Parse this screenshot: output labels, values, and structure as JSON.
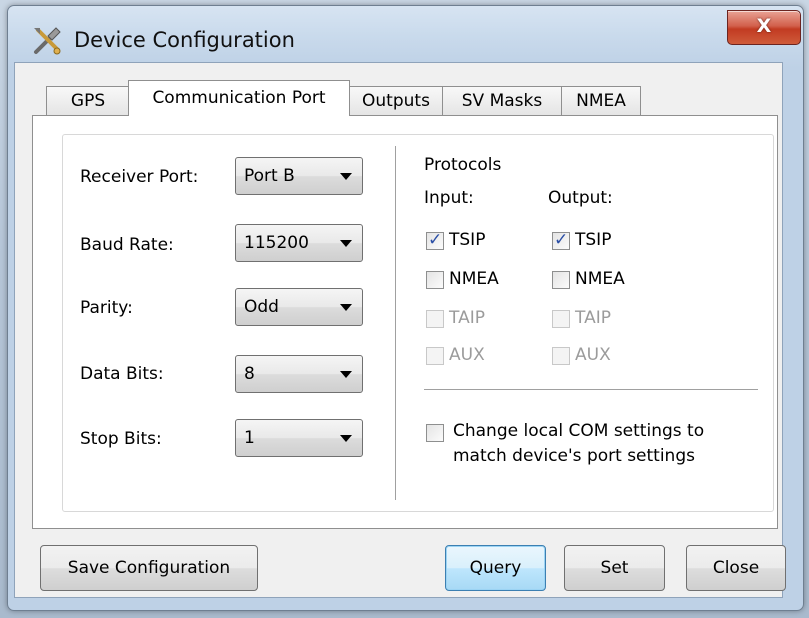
{
  "window": {
    "title": "Device Configuration",
    "close_label": "X"
  },
  "tabs": [
    {
      "label": "GPS"
    },
    {
      "label": "Communication Port"
    },
    {
      "label": "Outputs"
    },
    {
      "label": "SV Masks"
    },
    {
      "label": "NMEA"
    }
  ],
  "port_settings": {
    "receiver_port": {
      "label": "Receiver Port:",
      "value": "Port B"
    },
    "baud_rate": {
      "label": "Baud Rate:",
      "value": "115200"
    },
    "parity": {
      "label": "Parity:",
      "value": "Odd"
    },
    "data_bits": {
      "label": "Data Bits:",
      "value": "8"
    },
    "stop_bits": {
      "label": "Stop Bits:",
      "value": "1"
    }
  },
  "protocols": {
    "heading": "Protocols",
    "input_heading": "Input:",
    "output_heading": "Output:",
    "input": [
      {
        "label": "TSIP",
        "checked": true,
        "enabled": true
      },
      {
        "label": "NMEA",
        "checked": false,
        "enabled": true
      },
      {
        "label": "TAIP",
        "checked": false,
        "enabled": false
      },
      {
        "label": "AUX",
        "checked": false,
        "enabled": false
      }
    ],
    "output": [
      {
        "label": "TSIP",
        "checked": true,
        "enabled": true
      },
      {
        "label": "NMEA",
        "checked": false,
        "enabled": true
      },
      {
        "label": "TAIP",
        "checked": false,
        "enabled": false
      },
      {
        "label": "AUX",
        "checked": false,
        "enabled": false
      }
    ]
  },
  "local_com": {
    "line1": "Change local COM settings to",
    "line2": "match device's port settings",
    "checked": false
  },
  "buttons": {
    "save": "Save Configuration",
    "query": "Query",
    "set": "Set",
    "close": "Close"
  },
  "colors": {
    "accent_check": "#2a4ea5",
    "close_button": "#c23b22",
    "default_button": "#bee6fd"
  }
}
